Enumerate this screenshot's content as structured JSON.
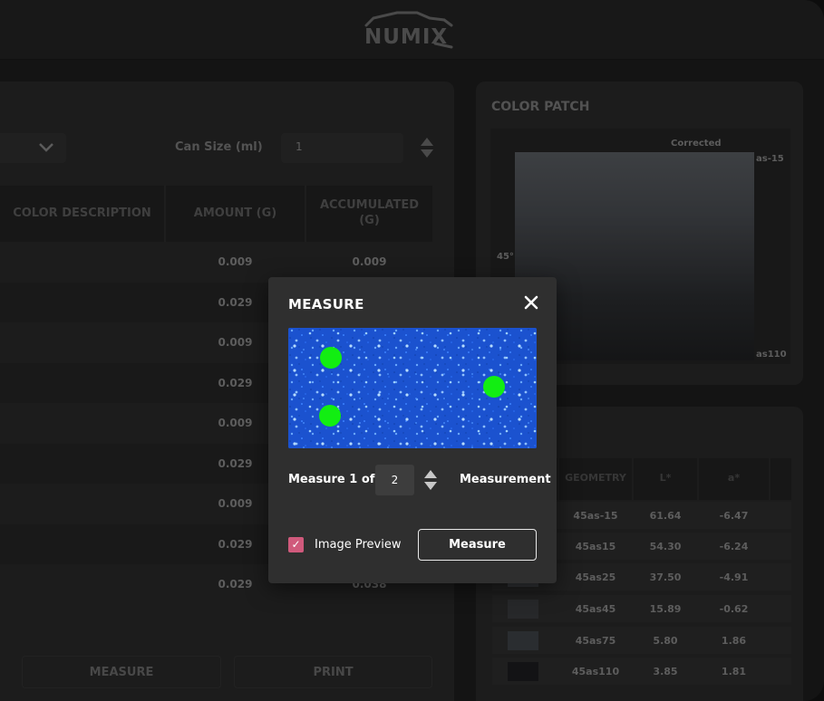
{
  "app": {
    "logo_text": "NUMIX"
  },
  "formula": {
    "can_size_label": "Can Size (ml)",
    "can_size_value": "1",
    "columns": [
      "COLOR DESCRIPTION",
      "AMOUNT (G)",
      "ACCUMULATED\n(G)"
    ],
    "rows": [
      {
        "amount": "0.009",
        "accumulated": "0.009"
      },
      {
        "amount": "0.029",
        "accumulated": ""
      },
      {
        "amount": "0.009",
        "accumulated": ""
      },
      {
        "amount": "0.029",
        "accumulated": ""
      },
      {
        "amount": "0.009",
        "accumulated": ""
      },
      {
        "amount": "0.029",
        "accumulated": ""
      },
      {
        "amount": "0.009",
        "accumulated": ""
      },
      {
        "amount": "0.029",
        "accumulated": ""
      },
      {
        "amount": "0.029",
        "accumulated": "0.038"
      }
    ],
    "measure_label": "MEASURE",
    "print_label": "PRINT"
  },
  "color_patch": {
    "title": "COLOR PATCH",
    "corrected_label": "Corrected",
    "angle_top": "as-15",
    "angle_mid": "45°",
    "angle_bottom": "as110"
  },
  "measurements": {
    "columns": [
      "GEOMETRY",
      "L*",
      "a*"
    ],
    "rows": [
      {
        "geometry": "45as-15",
        "L": "61.64",
        "a": "-6.47",
        "swatch": "#5a5f64"
      },
      {
        "geometry": "45as15",
        "L": "54.30",
        "a": "-6.24",
        "swatch": "#50555a"
      },
      {
        "geometry": "45as25",
        "L": "37.50",
        "a": "-4.91",
        "swatch": "#46494d"
      },
      {
        "geometry": "45as45",
        "L": "15.89",
        "a": "-0.62",
        "swatch": "#3a3c3e"
      },
      {
        "geometry": "45as75",
        "L": "5.80",
        "a": "1.86",
        "swatch": "#3f4348"
      },
      {
        "geometry": "45as110",
        "L": "3.85",
        "a": "1.81",
        "swatch": "#1c1d1f"
      }
    ]
  },
  "modal": {
    "title": "MEASURE",
    "close_icon": "close-icon",
    "measure_prefix": "Measure 1 of",
    "measure_count": "2",
    "measure_suffix": "Measurement",
    "image_preview_label": "Image Preview",
    "image_preview_checked": true,
    "measure_button": "Measure",
    "accent_color": "#d05a7c",
    "marker_color": "#12ee12"
  }
}
